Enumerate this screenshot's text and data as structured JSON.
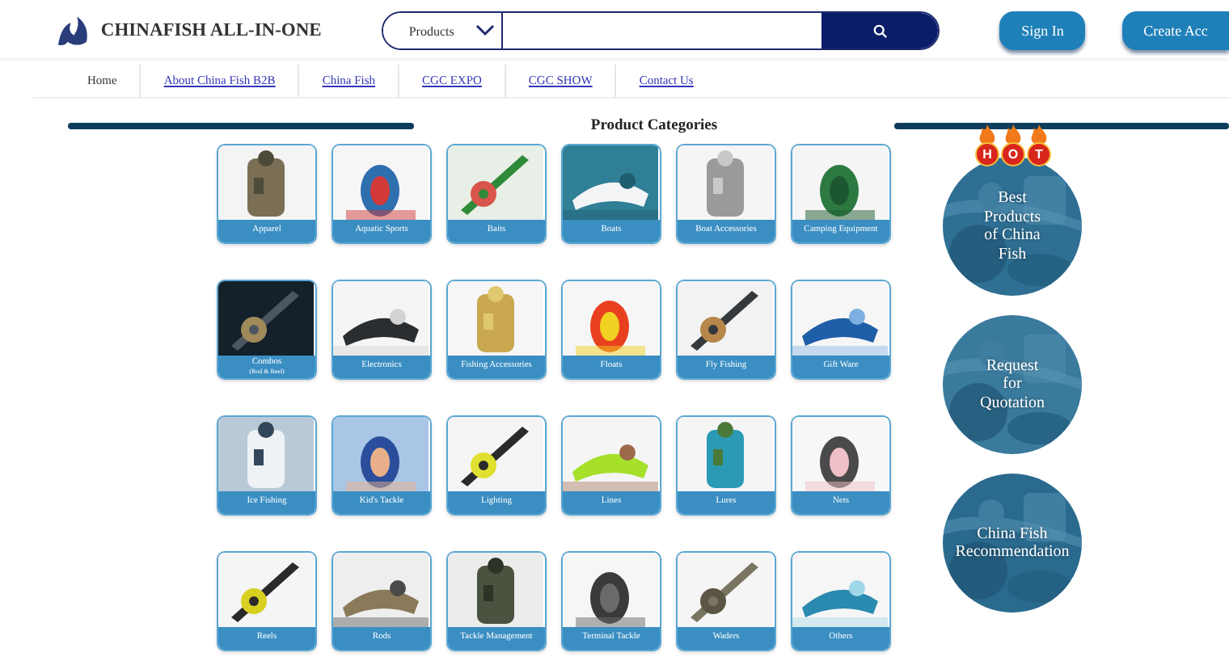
{
  "header": {
    "brand": "CHINAFISH ALL-IN-ONE",
    "search": {
      "category": "Products"
    },
    "buttons": [
      {
        "label": "Sign In"
      },
      {
        "label": "Create Acc"
      }
    ]
  },
  "nav": [
    {
      "label": "Home",
      "kind": "plain"
    },
    {
      "label": "About China Fish B2B",
      "kind": "link"
    },
    {
      "label": "China Fish",
      "kind": "link"
    },
    {
      "label": "CGC EXPO",
      "kind": "link"
    },
    {
      "label": "CGC SHOW",
      "kind": "link"
    },
    {
      "label": "Contact Us",
      "kind": "link"
    }
  ],
  "section_title": "Product Categories",
  "categories": [
    {
      "label": "Apparel"
    },
    {
      "label": "Aquatic Sports"
    },
    {
      "label": "Baits"
    },
    {
      "label": "Boats"
    },
    {
      "label": "Boat Accessories"
    },
    {
      "label": "Camping Equipment"
    },
    {
      "label": "Combos",
      "note": "(Rod & Reel)"
    },
    {
      "label": "Electronics"
    },
    {
      "label": "Fishing Accessories"
    },
    {
      "label": "Floats"
    },
    {
      "label": "Fly Fishing"
    },
    {
      "label": "Gift Ware"
    },
    {
      "label": "Ice Fishing"
    },
    {
      "label": "Kid's Tackle"
    },
    {
      "label": "Lighting"
    },
    {
      "label": "Lines"
    },
    {
      "label": "Lures"
    },
    {
      "label": "Nets"
    },
    {
      "label": "Reels"
    },
    {
      "label": "Rods"
    },
    {
      "label": "Tackle Management"
    },
    {
      "label": "Terminal Tackle"
    },
    {
      "label": "Waders"
    },
    {
      "label": "Others"
    }
  ],
  "promos": [
    {
      "lines": [
        "Best",
        "Products",
        "of China",
        "Fish"
      ],
      "hot": [
        "H",
        "O",
        "T"
      ]
    },
    {
      "lines": [
        "Request",
        "for",
        "Quotation"
      ]
    },
    {
      "lines": [
        "China Fish",
        "Recommendation"
      ]
    }
  ]
}
